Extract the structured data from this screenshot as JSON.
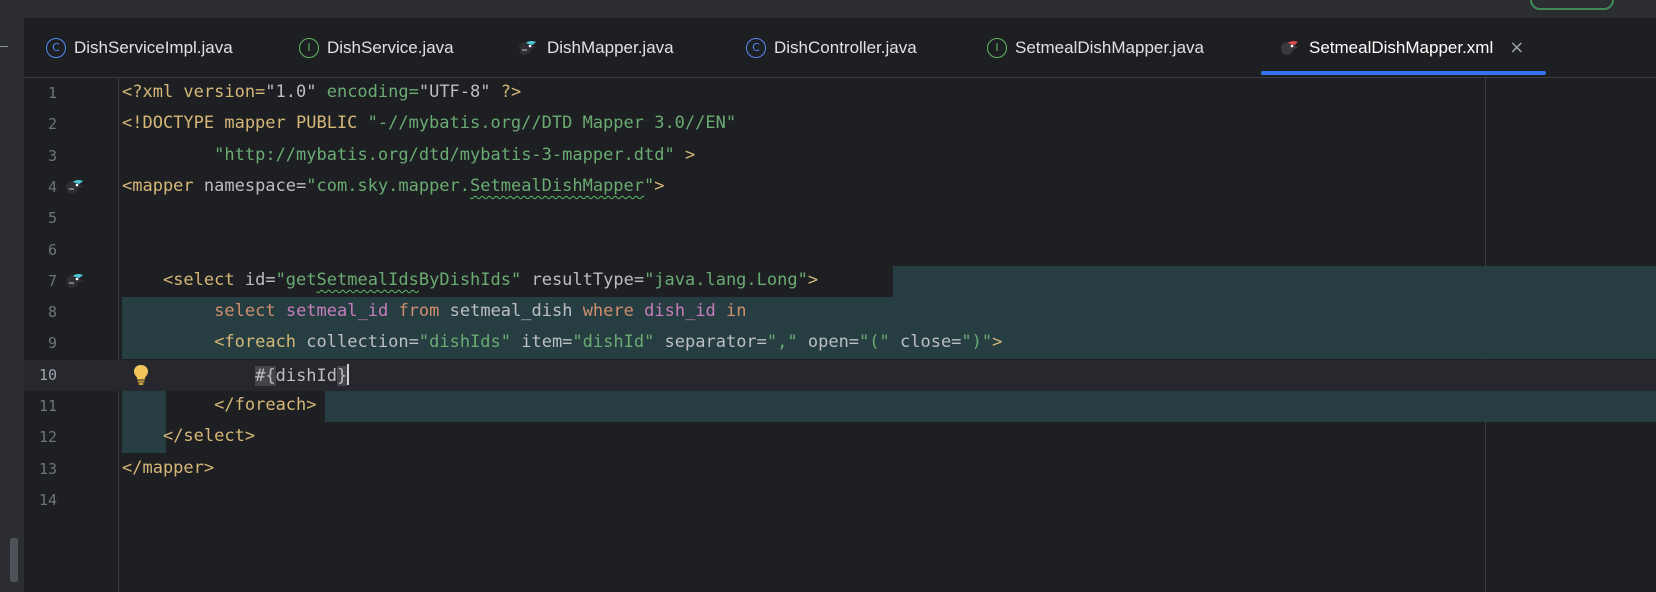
{
  "tabs": [
    {
      "label": "DishServiceImpl.java",
      "icon": "class-icon",
      "icon_glyph": "C"
    },
    {
      "label": "DishService.java",
      "icon": "interface-icon",
      "icon_glyph": "I"
    },
    {
      "label": "DishMapper.java",
      "icon": "mybatis-bird-icon",
      "icon_glyph": ""
    },
    {
      "label": "DishController.java",
      "icon": "class-icon",
      "icon_glyph": "C"
    },
    {
      "label": "SetmealDishMapper.java",
      "icon": "interface-icon",
      "icon_glyph": "I"
    },
    {
      "label": "SetmealDishMapper.xml",
      "icon": "mybatis-xml-icon",
      "icon_glyph": "",
      "active": true
    }
  ],
  "close_glyph": "×",
  "editor": {
    "current_line": 10,
    "line_numbers": [
      "1",
      "2",
      "3",
      "4",
      "5",
      "6",
      "7",
      "8",
      "9",
      "10",
      "11",
      "12",
      "13",
      "14"
    ],
    "lines": [
      [
        "<?xml version=",
        "\"1.0\"",
        " encoding=",
        "\"UTF-8\"",
        " ?>"
      ],
      [
        "<!DOCTYPE mapper PUBLIC ",
        "\"-//mybatis.org//DTD Mapper 3.0//EN\""
      ],
      [
        "\"http://mybatis.org/dtd/mybatis-3-mapper.dtd\"",
        " >"
      ],
      [
        "<mapper",
        " namespace=",
        "\"com.sky.mapper.",
        "SetmealDishMapper",
        "\"",
        ">"
      ],
      [],
      [],
      [
        "<select",
        " id=",
        "\"get",
        "SetmealIds",
        "ByDishIds\"",
        " resultType=",
        "\"java.lang.Long\"",
        ">"
      ],
      [
        "select",
        " ",
        "setmeal_id",
        " ",
        "from",
        " setmeal_dish ",
        "where",
        " ",
        "dish_id",
        " ",
        "in"
      ],
      [
        "<foreach",
        " collection=",
        "\"dishIds\"",
        " item=",
        "\"dishId\"",
        " separator=",
        "\",\"",
        " open=",
        "\"(\"",
        " close=",
        "\")\"",
        ">"
      ],
      [
        "#{",
        "dishId",
        "}"
      ],
      [
        "</foreach>"
      ],
      [
        "</select>"
      ],
      [
        "</mapper>"
      ],
      []
    ]
  },
  "gutter_icons": {
    "line_4": "mybatis-bird-icon",
    "line_7": "mybatis-bird-icon",
    "line_10": "lightbulb-icon"
  },
  "colors": {
    "tag": "#d5b778",
    "string": "#6aab73",
    "keyword": "#cf8e6d",
    "column": "#c77dbb",
    "highlight": "#263e42",
    "tab_underline": "#3574f0"
  }
}
